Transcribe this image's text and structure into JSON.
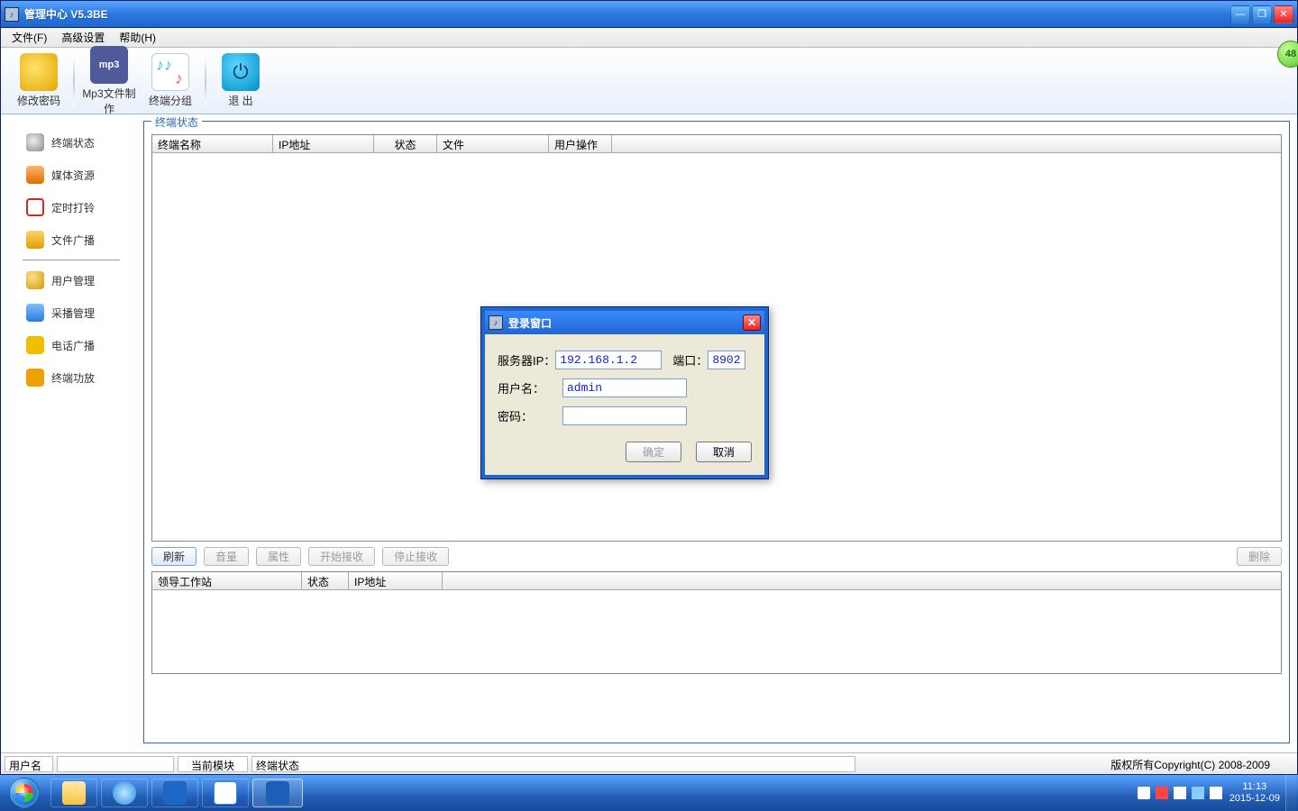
{
  "window": {
    "title": "管理中心 V5.3BE",
    "badge": "48"
  },
  "menus": [
    "文件(F)",
    "高级设置",
    "帮助(H)"
  ],
  "toolbar": {
    "changePwd": "修改密码",
    "mp3Make": "Mp3文件制作",
    "mp3Badge": "mp3",
    "termGroup": "终端分组",
    "exit": "退 出"
  },
  "sidebar": {
    "group1": [
      "终端状态",
      "媒体资源",
      "定时打铃",
      "文件广播"
    ],
    "group2": [
      "用户管理",
      "采播管理",
      "电话广播",
      "终端功放"
    ]
  },
  "work": {
    "group1Title": "终端状态",
    "cols1": [
      "终端名称",
      "IP地址",
      "状态",
      "文件",
      "用户操作"
    ],
    "btns": {
      "refresh": "刷新",
      "volume": "音量",
      "props": "属性",
      "startRecv": "开始接收",
      "stopRecv": "停止接收",
      "del": "删除"
    },
    "cols2": [
      "领导工作站",
      "状态",
      "IP地址"
    ]
  },
  "status": {
    "userLbl": "用户名",
    "curModLbl": "当前模块",
    "curModVal": "终端状态",
    "copyright": "版权所有Copyright(C) 2008-2009"
  },
  "dialog": {
    "title": "登录窗口",
    "serverIpLbl": "服务器IP：",
    "serverIpVal": "192.168.1.2",
    "portLbl": "端口：",
    "portVal": "8902",
    "userLbl": "用户名：",
    "userVal": "admin",
    "pwdLbl": "密码：",
    "pwdVal": "",
    "ok": "确定",
    "cancel": "取消"
  },
  "taskbar": {
    "time": "11:13",
    "date": "2015-12-09"
  }
}
